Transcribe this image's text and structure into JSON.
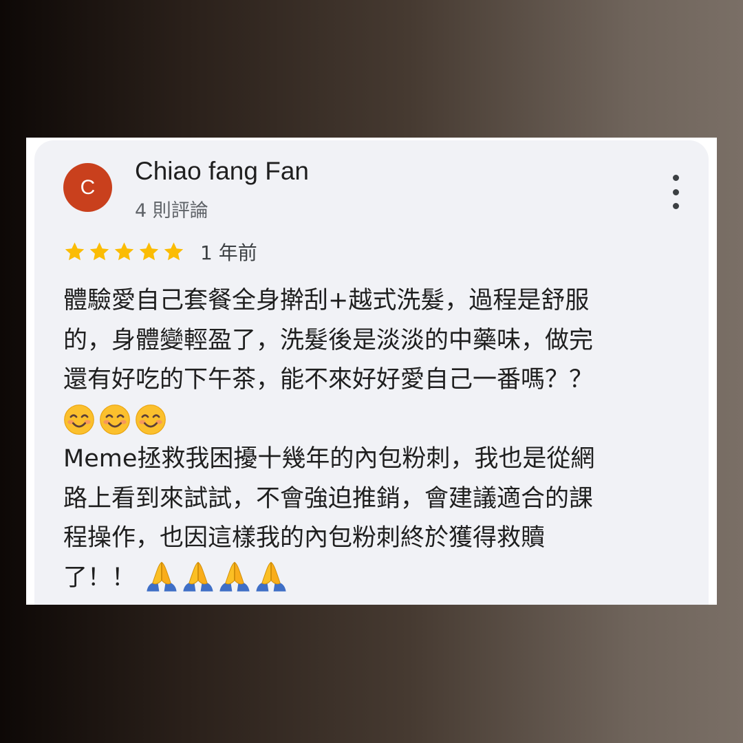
{
  "review": {
    "avatar_letter": "C",
    "avatar_color": "#c9401d",
    "reviewer_name": "Chiao fang Fan",
    "review_count": "4 則評論",
    "rating": 5,
    "rating_max": 5,
    "star_color": "#fbbc04",
    "date": "1 年前",
    "menu_icon": "more-vert-icon",
    "body_lines": [
      "體驗愛自己套餐全身擀刮+越式洗髮，過程是舒服",
      "的，身體變輕盈了，洗髮後是淡淡的中藥味，做完",
      "還有好吃的下午茶，能不來好好愛自己一番嗎？？",
      "",
      "Meme拯救我困擾十幾年的內包粉刺，我也是從網",
      "路上看到來試試，不會強迫推銷，會建議適合的課",
      "程操作，也因這樣我的內包粉刺終於獲得救贖",
      "了！！"
    ],
    "emoji_smiling": [
      "smiling-face-emoji",
      "smiling-face-emoji",
      "smiling-face-emoji"
    ],
    "emoji_praying": [
      "folded-hands-emoji",
      "folded-hands-emoji",
      "folded-hands-emoji",
      "folded-hands-emoji"
    ]
  }
}
